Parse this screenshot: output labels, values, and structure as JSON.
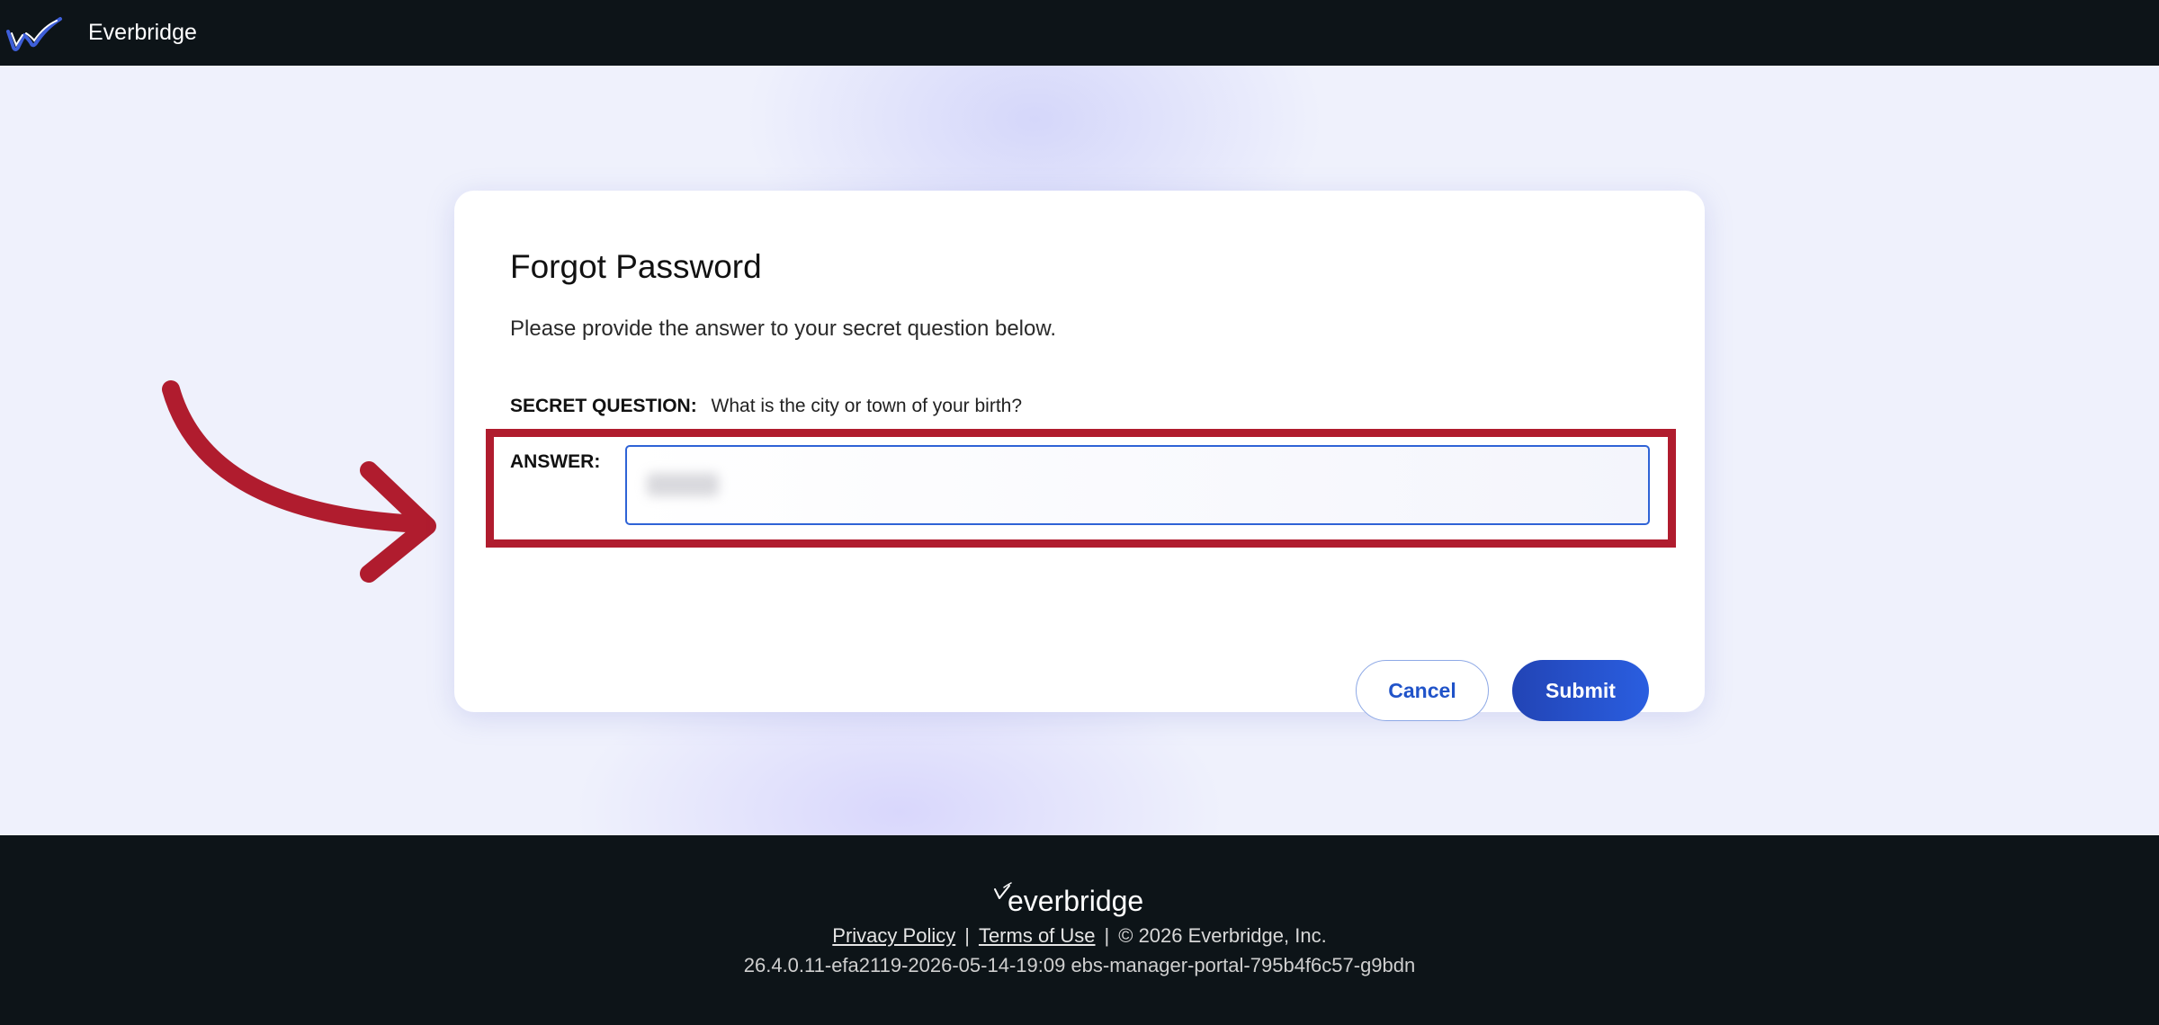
{
  "topbar": {
    "app_title": "Everbridge",
    "logo_icon": "everbridge-check-logo"
  },
  "form": {
    "title": "Forgot Password",
    "subtitle": "Please provide the answer to your secret question below.",
    "secret_question_label": "SECRET QUESTION:",
    "secret_question_text": "What is the city or town of your birth?",
    "answer_label": "ANSWER:",
    "answer_value": "",
    "cancel_label": "Cancel",
    "submit_label": "Submit"
  },
  "annotation": {
    "highlight_color": "#b01c2e",
    "arrow_icon": "curved-arrow-icon"
  },
  "footer": {
    "logo_text": "everbridge",
    "privacy_label": "Privacy Policy",
    "separator": "|",
    "terms_label": "Terms of Use",
    "copyright": "©  2026 Everbridge, Inc.",
    "version": "26.4.0.11-efa2119-2026-05-14-19:09 ebs-manager-portal-795b4f6c57-g9bdn"
  },
  "colors": {
    "topbar_bg": "#0d1418",
    "accent": "#2a5ee0",
    "page_bg": "#eff1fc"
  }
}
